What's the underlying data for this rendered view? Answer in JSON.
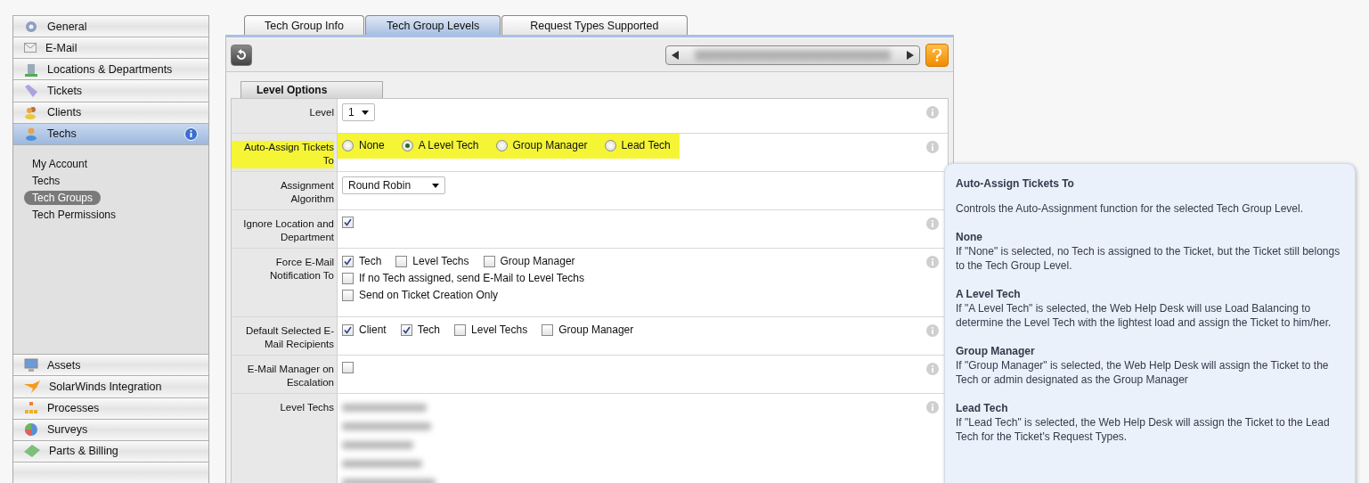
{
  "sidebar": {
    "top_items": [
      {
        "label": "General",
        "selected": false
      },
      {
        "label": "E-Mail",
        "selected": false
      },
      {
        "label": "Locations & Departments",
        "selected": false
      },
      {
        "label": "Tickets",
        "selected": false
      },
      {
        "label": "Clients",
        "selected": false
      },
      {
        "label": "Techs",
        "selected": true
      }
    ],
    "sub_items": [
      {
        "label": "My Account",
        "selected": false
      },
      {
        "label": "Techs",
        "selected": false
      },
      {
        "label": "Tech Groups",
        "selected": true
      },
      {
        "label": "Tech Permissions",
        "selected": false
      }
    ],
    "bottom_items": [
      {
        "label": "Assets",
        "selected": false
      },
      {
        "label": "SolarWinds Integration",
        "selected": false
      },
      {
        "label": "Processes",
        "selected": false
      },
      {
        "label": "Surveys",
        "selected": false
      },
      {
        "label": "Parts & Billing",
        "selected": false
      }
    ]
  },
  "tabs": [
    {
      "label": "Tech Group Info",
      "selected": false
    },
    {
      "label": "Tech Group Levels",
      "selected": true
    },
    {
      "label": "Request Types Supported",
      "selected": false
    }
  ],
  "section_tab": "Level Options",
  "form": [
    {
      "kind": "select",
      "label": "Level",
      "value": "1",
      "highlighted": false,
      "info": true
    },
    {
      "kind": "radios",
      "label": "Auto-Assign Tickets To",
      "highlighted": true,
      "info": true,
      "options": [
        {
          "label": "None",
          "selected": false
        },
        {
          "label": "A Level Tech",
          "selected": true
        },
        {
          "label": "Group Manager",
          "selected": false
        },
        {
          "label": "Lead Tech",
          "selected": false
        }
      ]
    },
    {
      "kind": "select",
      "label": "Assignment Algorithm",
      "value": "Round Robin",
      "highlighted": false,
      "info": false
    },
    {
      "kind": "checks",
      "label": "Ignore Location and Department",
      "highlighted": false,
      "info": true,
      "lines": [
        [
          {
            "checked": true
          }
        ]
      ]
    },
    {
      "kind": "checks",
      "label": "Force E-Mail Notification To",
      "highlighted": false,
      "info": true,
      "lines": [
        [
          {
            "label": "Tech",
            "checked": true
          },
          {
            "label": "Level Techs",
            "checked": false
          },
          {
            "label": "Group Manager",
            "checked": false
          }
        ],
        [
          {
            "label": "If no Tech assigned, send E-Mail to Level Techs",
            "checked": false
          }
        ],
        [
          {
            "label": "Send on Ticket Creation Only",
            "checked": false
          }
        ]
      ]
    },
    {
      "kind": "checks",
      "label": "Default Selected E-Mail Recipients",
      "highlighted": false,
      "info": true,
      "lines": [
        [
          {
            "label": "Client",
            "checked": true
          },
          {
            "label": "Tech",
            "checked": true
          },
          {
            "label": "Level Techs",
            "checked": false
          },
          {
            "label": "Group Manager",
            "checked": false
          }
        ]
      ]
    },
    {
      "kind": "checks",
      "label": "E-Mail Manager on Escalation",
      "highlighted": false,
      "info": true,
      "lines": [
        [
          {
            "checked": false
          }
        ]
      ]
    },
    {
      "kind": "redacted",
      "label": "Level Techs",
      "highlighted": false,
      "info": true,
      "items": [
        {
          "kind": "redacted"
        },
        {
          "kind": "redacted"
        },
        {
          "kind": "redacted"
        },
        {
          "kind": "redacted"
        },
        {
          "kind": "redacted"
        }
      ]
    }
  ],
  "tooltip": {
    "title": "Auto-Assign Tickets To",
    "intro": "Controls the Auto-Assignment function for the selected Tech Group Level.",
    "sections": [
      {
        "heading": "None",
        "text": "If \"None\" is selected, no Tech is assigned to the Ticket, but the Ticket still belongs to the Tech Group Level."
      },
      {
        "heading": "A Level Tech",
        "text": "If \"A Level Tech\" is selected, the Web Help Desk will use Load Balancing to determine the Level Tech with the lightest load and assign the Ticket to him/her."
      },
      {
        "heading": "Group Manager",
        "text": "If \"Group Manager\" is selected, the Web Help Desk will assign the Ticket to the Tech or admin designated as the Group Manager"
      },
      {
        "heading": "Lead Tech",
        "text": "If \"Lead Tech\" is selected, the Web Help Desk will assign the Ticket to the Lead Tech for the Ticket's Request Types."
      }
    ]
  }
}
